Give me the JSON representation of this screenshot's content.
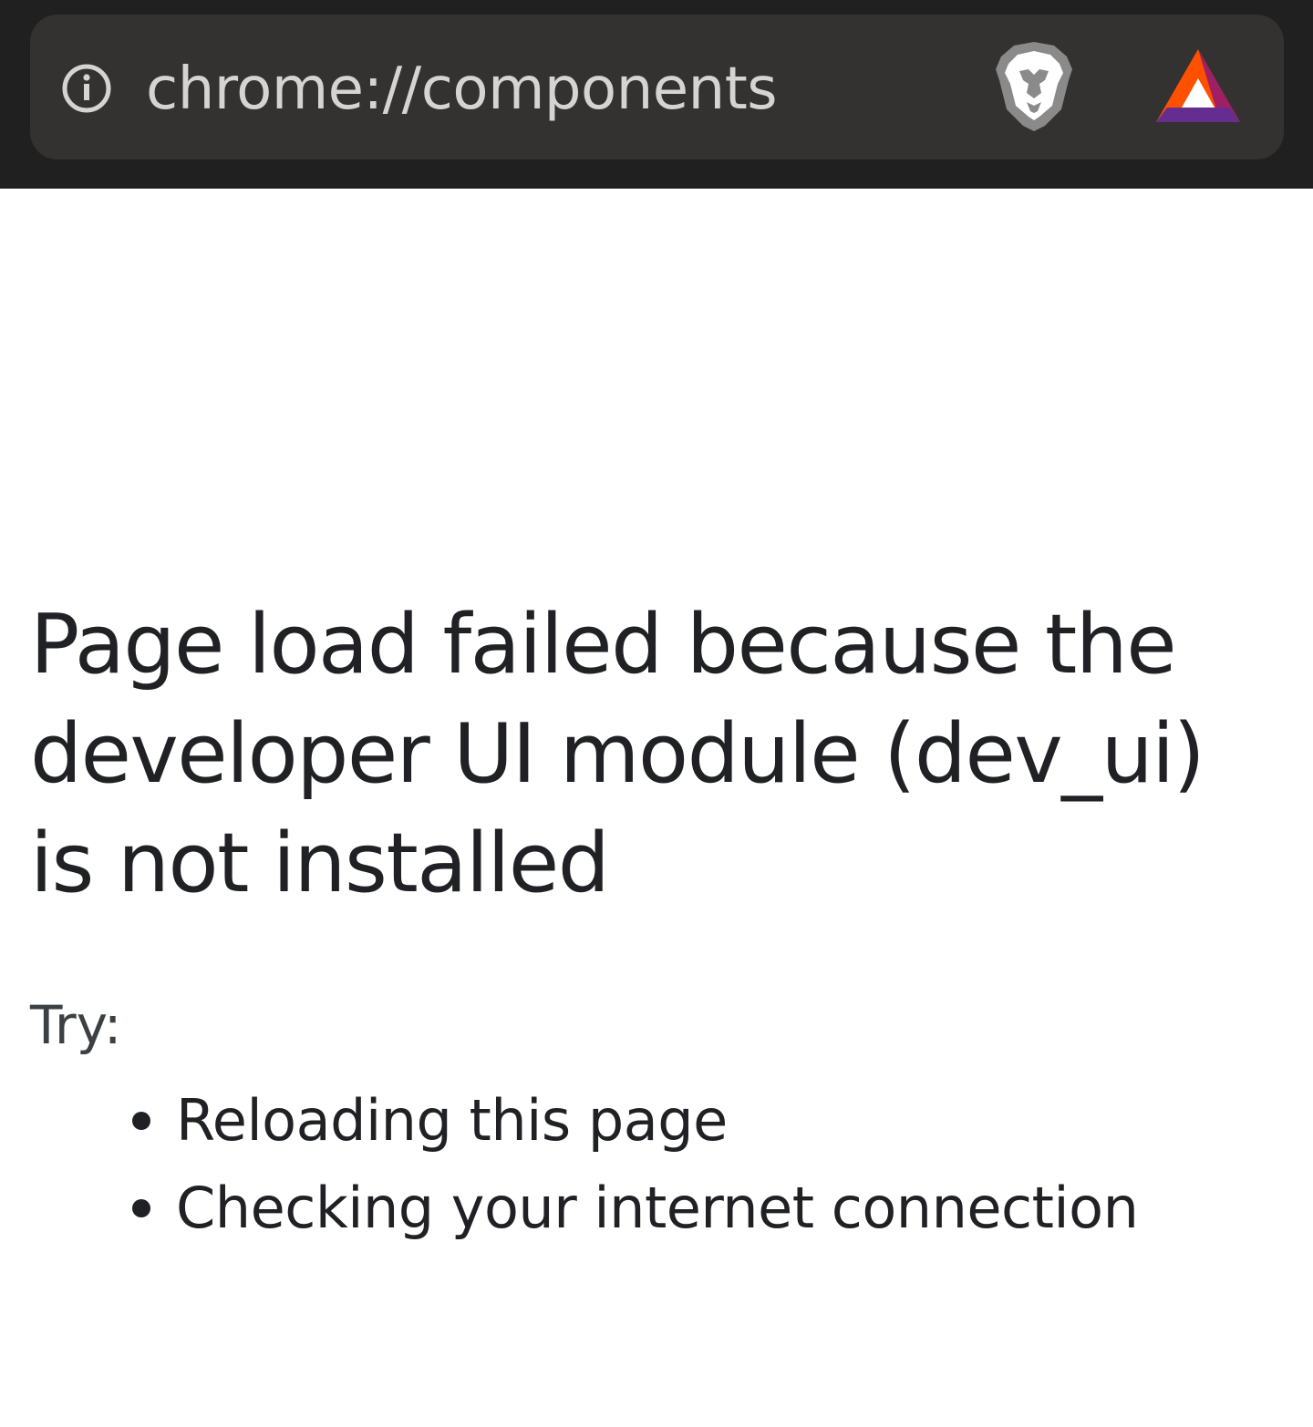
{
  "address_bar": {
    "url": "chrome://components",
    "site_info_icon": "info-circle-icon",
    "shields_icon": "brave-lion-shield-icon",
    "rewards_icon": "bat-triangle-icon"
  },
  "error_page": {
    "title": "Page load failed because the developer UI module (dev_ui) is not installed",
    "try_label": "Try:",
    "suggestions": [
      "Reloading this page",
      "Checking your internet connection"
    ]
  },
  "colors": {
    "toolbar_bg": "#202020",
    "omnibox_bg": "#333231",
    "url_text": "#d4d4d4",
    "page_bg": "#ffffff",
    "text": "#202124",
    "bat_orange": "#ff5000",
    "bat_purple": "#662d91",
    "bat_red": "#9e1f63"
  }
}
